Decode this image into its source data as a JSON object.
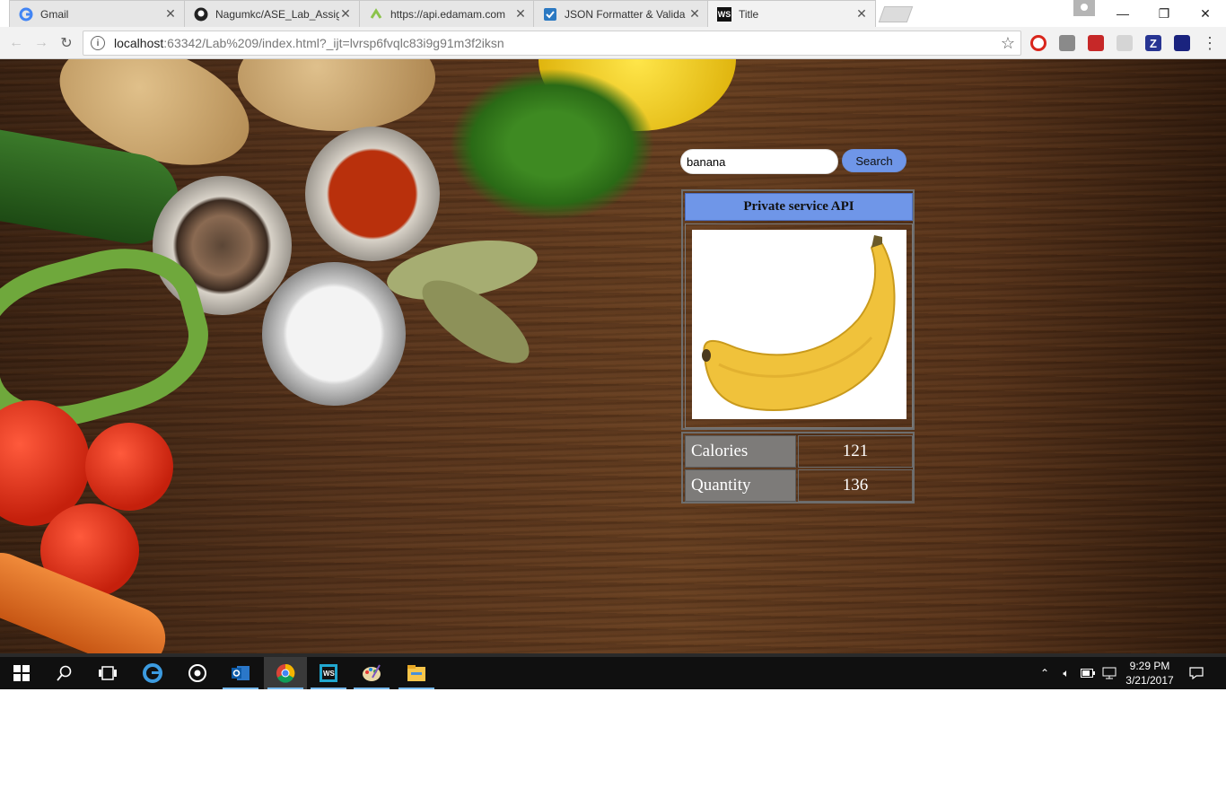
{
  "browser": {
    "tabs": [
      {
        "title": "Gmail",
        "favicon": "google-icon",
        "active": false
      },
      {
        "title": "Nagumkc/ASE_Lab_Assig",
        "favicon": "github-icon",
        "active": false
      },
      {
        "title": "https://api.edamam.com",
        "favicon": "link-icon",
        "active": false
      },
      {
        "title": "JSON Formatter & Valida",
        "favicon": "checkbox-icon",
        "active": false
      },
      {
        "title": "Title",
        "favicon": "webstorm-icon",
        "active": true
      }
    ],
    "address": {
      "host": "localhost",
      "rest": ":63342/Lab%209/index.html?_ijt=lvrsp6fvqlc83i9g91m3f2iksn"
    }
  },
  "page": {
    "search": {
      "value": "banana",
      "button_label": "Search"
    },
    "api_header": "Private service API",
    "nutrition": [
      {
        "label": "Calories",
        "value": "121"
      },
      {
        "label": "Quantity",
        "value": "136"
      }
    ]
  },
  "taskbar": {
    "time": "9:29 PM",
    "date": "3/21/2017",
    "apps": [
      "windows-start-icon",
      "search-icon",
      "task-view-icon",
      "edge-icon",
      "groove-icon",
      "outlook-icon",
      "chrome-icon",
      "webstorm-icon",
      "paint-icon",
      "file-explorer-icon"
    ]
  },
  "colors": {
    "accent_blue": "#6f96e8",
    "label_gray": "#7d7b79",
    "wood": "#5a361d"
  }
}
